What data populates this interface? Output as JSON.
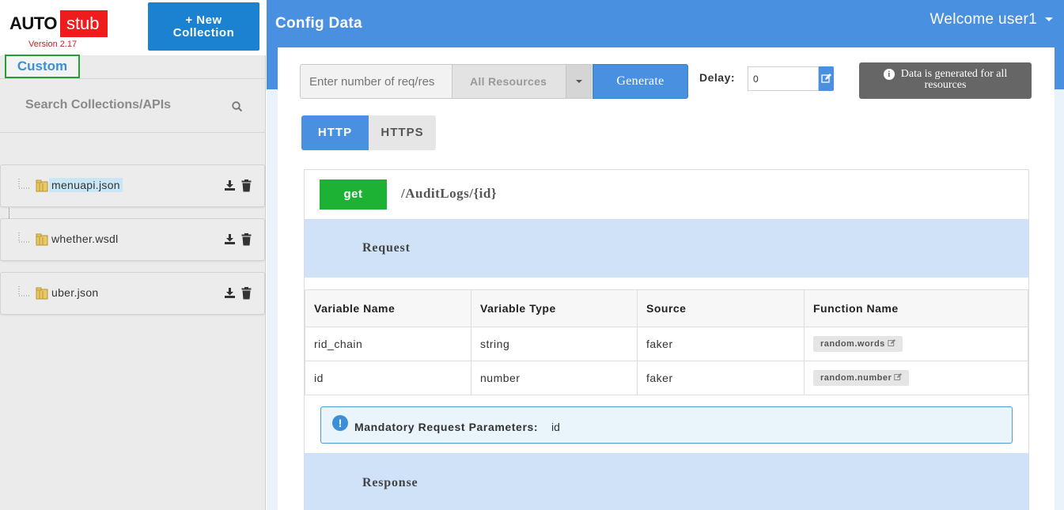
{
  "brand": {
    "logo_left": "AUTO",
    "logo_right": "stub",
    "version": "Version 2.17"
  },
  "sidebar": {
    "new_collection_line1": "+ New",
    "new_collection_line2": "Collection",
    "custom_tab": "Custom",
    "search_placeholder": "Search Collections/APIs",
    "collections": [
      {
        "name": "menuapi.json",
        "selected": true
      },
      {
        "name": "whether.wsdl",
        "selected": false
      },
      {
        "name": "uber.json",
        "selected": false
      }
    ]
  },
  "header": {
    "title": "Config Data",
    "welcome": "Welcome user1"
  },
  "toolbar": {
    "req_placeholder": "Enter number of req/res",
    "resource_select": "All Resources",
    "generate_label": "Generate",
    "delay_label": "Delay:",
    "delay_value": "0",
    "info_line1": "Data is generated for all",
    "info_line2": "resources"
  },
  "protocol_tabs": {
    "http": "HTTP",
    "https": "HTTPS",
    "active": "HTTP"
  },
  "api": {
    "method": "get",
    "path": "/AuditLogs/{id}",
    "request_title": "Request",
    "table_headers": [
      "Variable Name",
      "Variable Type",
      "Source",
      "Function Name"
    ],
    "rows": [
      {
        "name": "rid_chain",
        "type": "string",
        "source": "faker",
        "function": "random.words"
      },
      {
        "name": "id",
        "type": "number",
        "source": "faker",
        "function": "random.number"
      }
    ],
    "mandatory_label": "Mandatory Request Parameters:",
    "mandatory_value": "id",
    "response_title": "Response"
  },
  "colors": {
    "header_blue": "#4a90e0",
    "new_collection_blue": "#1a82d0",
    "method_green": "#1db233",
    "band_blue": "#cfe2f8",
    "logo_red": "#ee1c1c",
    "info_gray": "#666666"
  }
}
